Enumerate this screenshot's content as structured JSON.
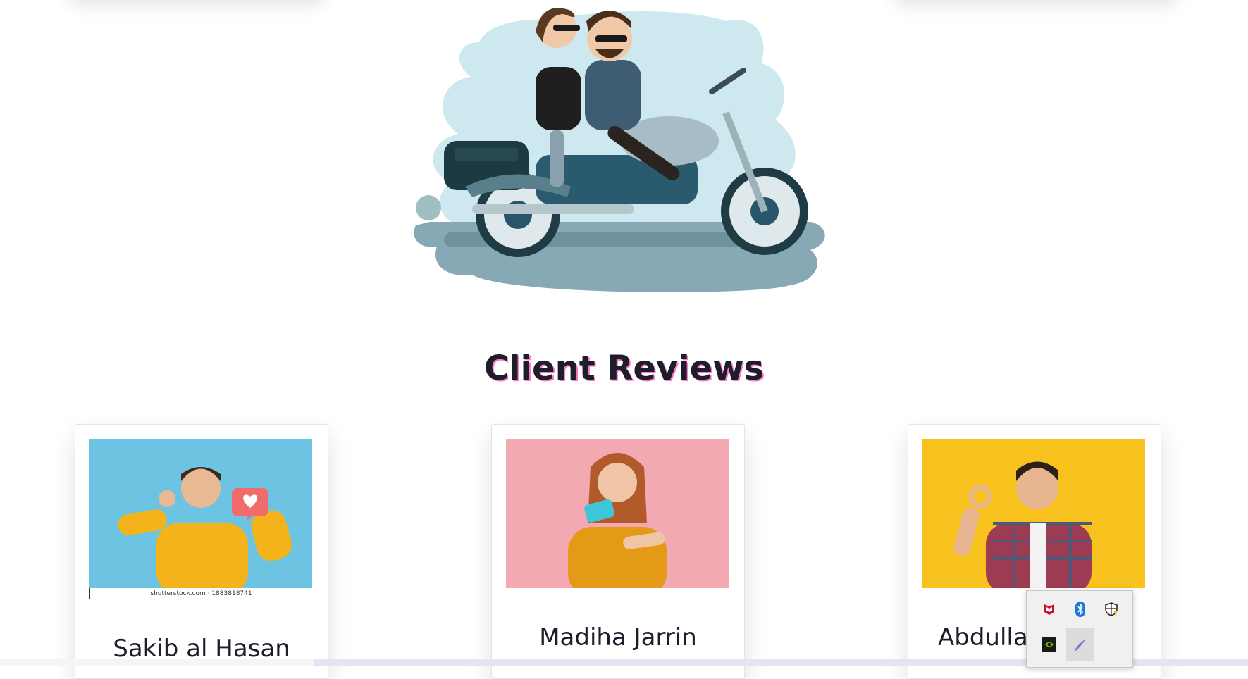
{
  "section": {
    "title": "Client Reviews"
  },
  "reviews": [
    {
      "name": "Sakib al Hasan",
      "photo_credit": "shutterstock.com · 1883818741"
    },
    {
      "name": "Madiha Jarrin"
    },
    {
      "name": "Abdulla"
    }
  ],
  "tray": {
    "icons": [
      "mcafee-icon",
      "bluetooth-icon",
      "security-shield-icon",
      "nvidia-icon",
      "pen-icon"
    ]
  },
  "colors": {
    "title_shadow": "#ff7ac6",
    "card1_bg": "#6cc3e2",
    "card2_bg": "#f2a9b2",
    "card3_bg": "#f7c21e"
  }
}
